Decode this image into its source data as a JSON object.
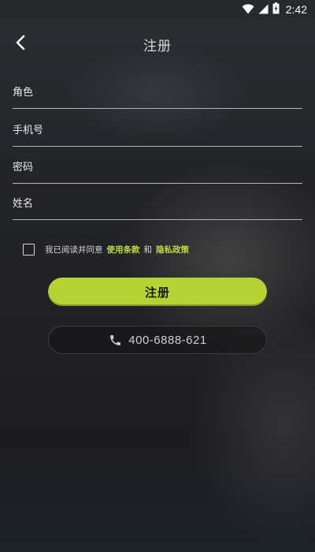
{
  "status_bar": {
    "time": "2:42",
    "icons": [
      "wifi-icon",
      "signal-icon",
      "battery-icon"
    ]
  },
  "header": {
    "back_icon": "chevron-left-icon",
    "title": "注册"
  },
  "form": {
    "fields": [
      {
        "placeholder": "角色",
        "value": ""
      },
      {
        "placeholder": "手机号",
        "value": ""
      },
      {
        "placeholder": "密码",
        "value": ""
      },
      {
        "placeholder": "姓名",
        "value": ""
      }
    ]
  },
  "agreement": {
    "checked": false,
    "prefix": "我已阅读并同意",
    "terms_link": "使用条款",
    "conjunction": "和",
    "privacy_link": "隐私政策"
  },
  "register_button": {
    "label": "注册"
  },
  "phone_button": {
    "icon": "phone-icon",
    "number": "400-6888-621"
  },
  "colors": {
    "accent": "#b6d334",
    "link": "#c2d93a",
    "background": "#1f2124"
  }
}
